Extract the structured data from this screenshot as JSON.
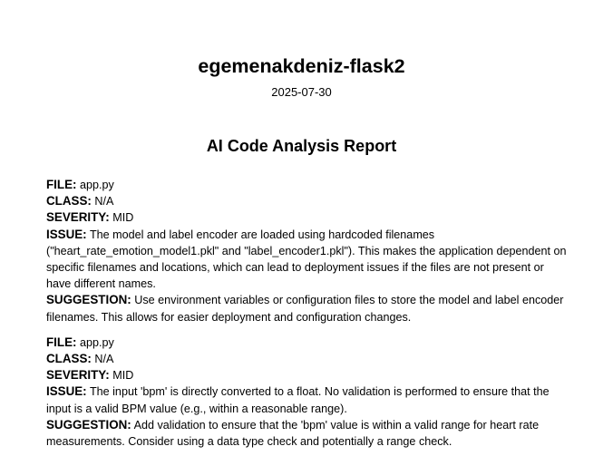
{
  "header": {
    "repo_name": "egemenakdeniz-flask2",
    "date": "2025-07-30",
    "report_title": "AI Code Analysis Report"
  },
  "labels": {
    "file": "FILE:",
    "class": "CLASS:",
    "severity": "SEVERITY:",
    "issue": "ISSUE:",
    "suggestion": "SUGGESTION:"
  },
  "findings": [
    {
      "file": "app.py",
      "class": "N/A",
      "severity": "MID",
      "issue": "The model and label encoder are loaded using hardcoded filenames (\"heart_rate_emotion_model1.pkl\" and \"label_encoder1.pkl\"). This makes the application dependent on specific filenames and locations, which can lead to deployment issues if the files are not present or have different names.",
      "suggestion": "Use environment variables or configuration files to store the model and label encoder filenames. This allows for easier deployment and configuration changes."
    },
    {
      "file": "app.py",
      "class": "N/A",
      "severity": "MID",
      "issue": "The input 'bpm' is directly converted to a float. No validation is performed to ensure that the input is a valid BPM value (e.g., within a reasonable range).",
      "suggestion": "Add validation to ensure that the 'bpm' value is within a valid range for heart rate measurements.  Consider using a data type check and potentially a range check."
    }
  ]
}
